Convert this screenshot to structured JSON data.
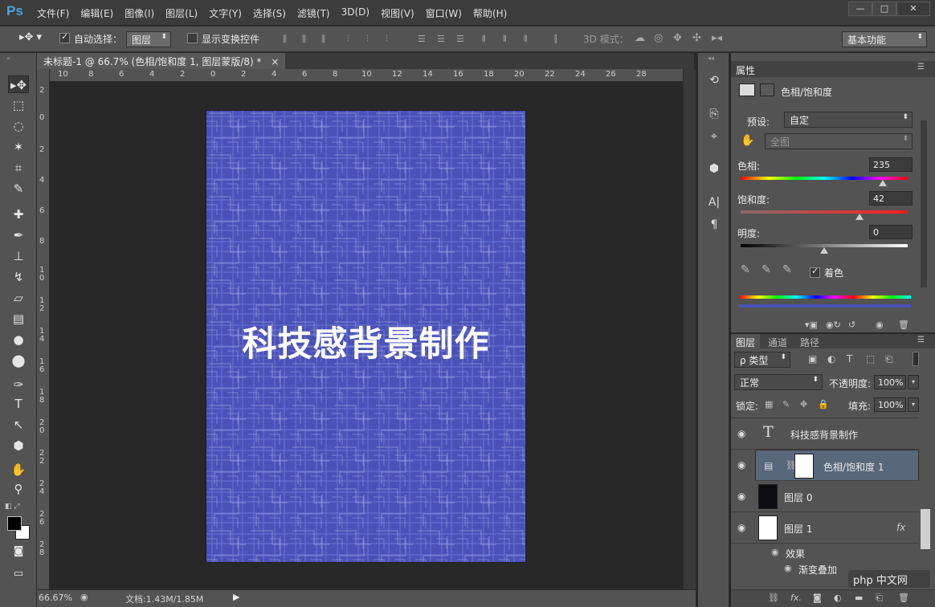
{
  "app": {
    "logo": "Ps"
  },
  "menu": [
    "文件(F)",
    "编辑(E)",
    "图像(I)",
    "图层(L)",
    "文字(Y)",
    "选择(S)",
    "滤镜(T)",
    "3D(D)",
    "视图(V)",
    "窗口(W)",
    "帮助(H)"
  ],
  "window_controls": {
    "min": "—",
    "max": "□",
    "close": "✕"
  },
  "options_bar": {
    "auto_select_label": "自动选择：",
    "auto_select_value": "图层",
    "show_transform_label": "显示变换控件",
    "mode_3d_label": "3D 模式：",
    "workspace": "基本功能"
  },
  "document_tab": {
    "title": "未标题-1 @ 66.7% (色相/饱和度 1, 图层蒙版/8) *",
    "close": "×"
  },
  "ruler_top": [
    "10",
    "8",
    "6",
    "4",
    "2",
    "0",
    "2",
    "4",
    "6",
    "8",
    "10",
    "12",
    "14",
    "16",
    "18",
    "20",
    "22",
    "24",
    "26",
    "28"
  ],
  "ruler_left": [
    "2",
    "0",
    "2",
    "4",
    "6",
    "8",
    "1 0",
    "1 2",
    "1 4",
    "1 6",
    "1 8",
    "2 0",
    "2 2",
    "2 4",
    "2 6",
    "2 8"
  ],
  "canvas": {
    "text": "科技感背景制作",
    "bg_color": "#4a52b8"
  },
  "status": {
    "zoom": "66.67%",
    "doc_size": "文档:1.43M/1.85M"
  },
  "properties": {
    "title": "属性",
    "subtitle": "色相/饱和度",
    "preset_label": "预设:",
    "preset_value": "自定",
    "channel_value": "全图",
    "hue_label": "色相:",
    "hue_value": "235",
    "hue_fraction": 0.853,
    "saturation_label": "饱和度:",
    "saturation_value": "42",
    "saturation_fraction": 0.71,
    "lightness_label": "明度:",
    "lightness_value": "0",
    "lightness_fraction": 0.5,
    "colorize_label": "着色"
  },
  "layers": {
    "tabs": [
      "图层",
      "通道",
      "路径"
    ],
    "filter_label": "ρ 类型",
    "blend_mode": "正常",
    "opacity_label": "不透明度:",
    "opacity_value": "100%",
    "lock_label": "锁定:",
    "fill_label": "填充:",
    "fill_value": "100%",
    "items": [
      {
        "name": "科技感背景制作",
        "type": "text"
      },
      {
        "name": "色相/饱和度 1",
        "type": "adjustment"
      },
      {
        "name": "图层 0",
        "type": "pixel"
      },
      {
        "name": "图层 1",
        "type": "pixel-fx"
      }
    ],
    "effects_label": "效果",
    "effect_item": "渐变叠加",
    "fx": "fx"
  },
  "watermark": "php 中文网"
}
